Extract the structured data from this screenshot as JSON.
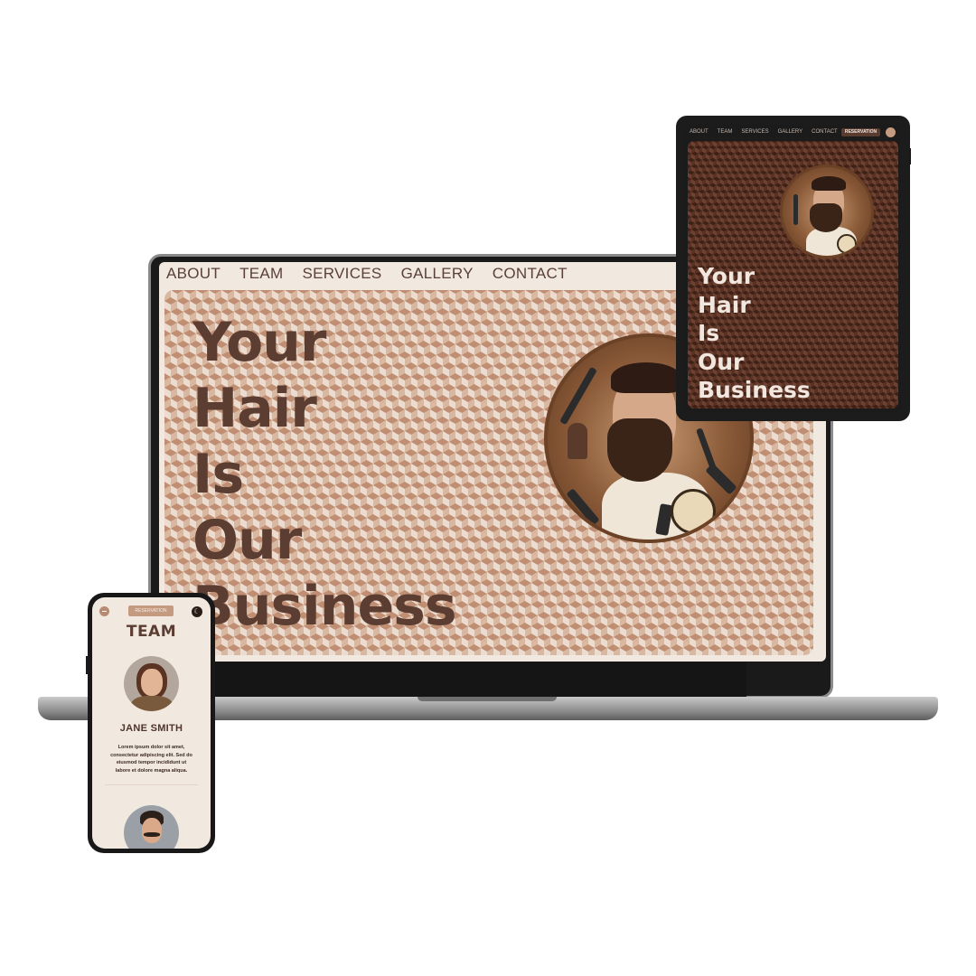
{
  "laptop": {
    "nav": [
      "ABOUT",
      "TEAM",
      "SERVICES",
      "GALLERY",
      "CONTACT"
    ],
    "hero_lines": [
      "Your",
      "Hair",
      "Is",
      "Our",
      "Business"
    ]
  },
  "tablet": {
    "nav": [
      "ABOUT",
      "TEAM",
      "SERVICES",
      "GALLERY",
      "CONTACT"
    ],
    "reservation_label": "RESERVATION",
    "hero_lines": [
      "Your",
      "Hair",
      "Is",
      "Our",
      "Business"
    ]
  },
  "phone": {
    "reservation_label": "RESERVATION",
    "section_title": "TEAM",
    "member": {
      "name": "JANE SMITH",
      "bio": "Lorem ipsum dolor sit amet, consectetur adipiscing elit. Sed do eiusmod tempor incididunt ut labore et dolore magna aliqua."
    }
  },
  "colors": {
    "brand_brown": "#5b3d32",
    "cream": "#f1e9df",
    "accent_tan": "#c49a80"
  }
}
